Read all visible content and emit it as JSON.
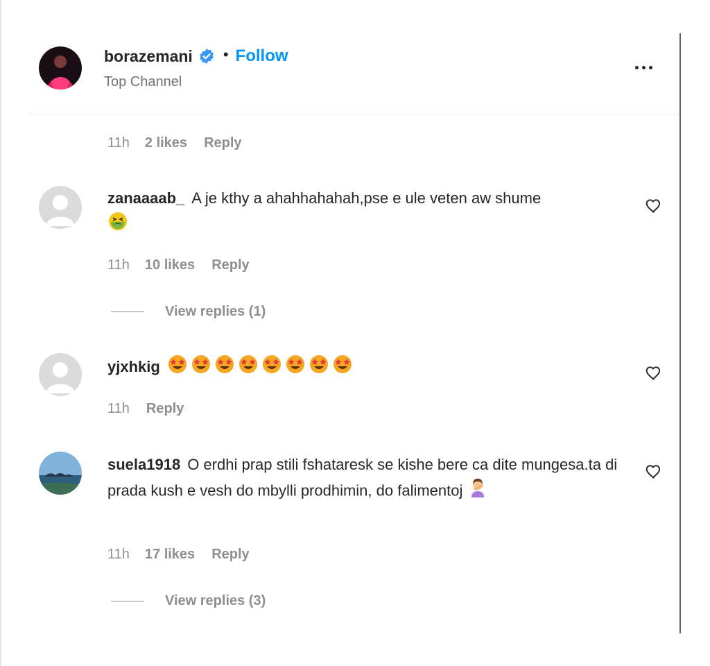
{
  "post": {
    "username": "borazemani",
    "follow_label": "Follow",
    "separator": "•",
    "subtitle": "Top Channel"
  },
  "top_comment_meta": {
    "time": "11h",
    "likes": "2 likes",
    "reply": "Reply"
  },
  "comments": [
    {
      "username": "zanaaaab_",
      "text": "A je kthy a ahahhahahah,pse e ule veten aw shume",
      "emojis": [
        "nauseated-face"
      ],
      "time": "11h",
      "likes": "10 likes",
      "reply": "Reply",
      "view_replies": "View replies (1)"
    },
    {
      "username": "yjxhkig",
      "text": "",
      "emojis": [
        "star-struck",
        "star-struck",
        "star-struck",
        "star-struck",
        "star-struck",
        "star-struck",
        "star-struck",
        "star-struck"
      ],
      "time": "11h",
      "reply": "Reply"
    },
    {
      "username": "suela1918",
      "text": "O erdhi prap stili fshataresk se kishe bere ca dite mungesa.ta di prada kush e vesh do mbylli prodhimin, do falimentoj",
      "emojis": [
        "woman-facepalming"
      ],
      "time": "11h",
      "likes": "17 likes",
      "reply": "Reply",
      "view_replies": "View replies (3)"
    }
  ],
  "colors": {
    "link_blue": "#0095f6",
    "meta_gray": "#8e8e8e",
    "text": "#262626"
  }
}
